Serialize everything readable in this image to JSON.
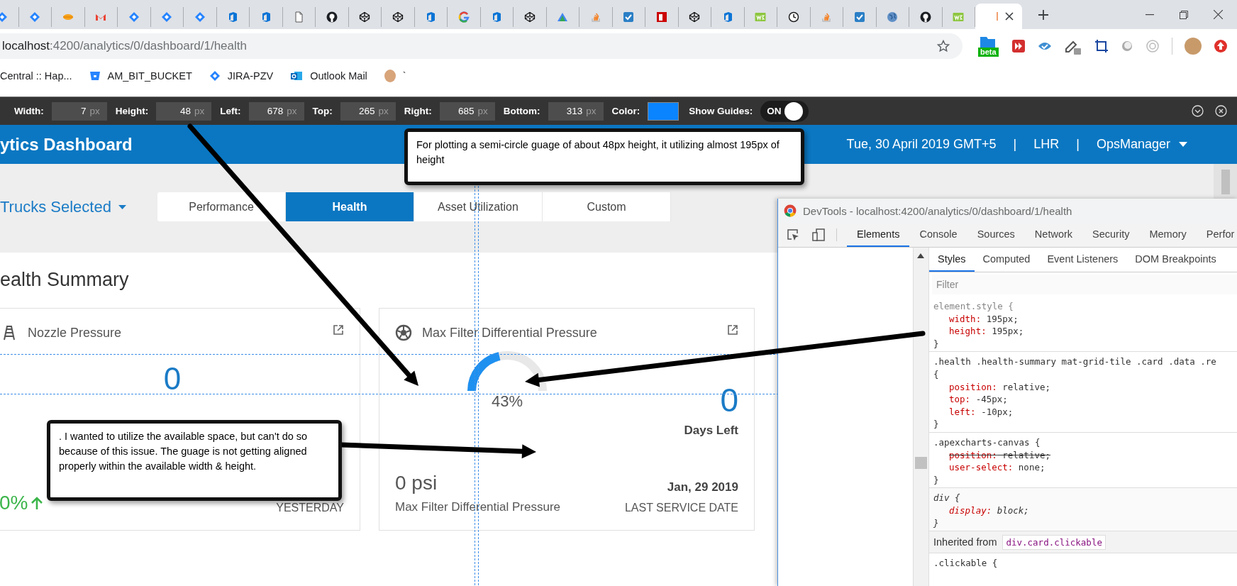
{
  "browser": {
    "tabs": [
      {
        "selected": false
      },
      {
        "selected": false
      },
      {
        "selected": false
      },
      {
        "selected": false
      },
      {
        "selected": false
      },
      {
        "selected": false
      },
      {
        "selected": false
      },
      {
        "selected": false
      },
      {
        "selected": false
      },
      {
        "selected": false
      },
      {
        "selected": false
      },
      {
        "selected": false
      },
      {
        "selected": false
      },
      {
        "selected": false
      },
      {
        "selected": false
      },
      {
        "selected": false
      },
      {
        "selected": false
      },
      {
        "selected": false
      },
      {
        "selected": false
      },
      {
        "selected": false
      },
      {
        "selected": false
      },
      {
        "selected": false
      },
      {
        "selected": false
      },
      {
        "selected": false
      },
      {
        "selected": false
      },
      {
        "selected": false
      },
      {
        "selected": false
      },
      {
        "selected": false
      },
      {
        "selected": false
      },
      {
        "selected": false
      },
      {
        "selected": true
      }
    ],
    "address": {
      "host": "localhost",
      "path": ":4200/analytics/0/dashboard/1/health"
    },
    "extension_badge": "beta",
    "bookmarks": [
      {
        "label": "Central :: Hap..."
      },
      {
        "label": "AM_BIT_BUCKET"
      },
      {
        "label": "JIRA-PZV"
      },
      {
        "label": "Outlook Mail"
      },
      {
        "label": "`"
      }
    ]
  },
  "measure_toolbar": {
    "fields": [
      {
        "label": "Width:",
        "value": "7",
        "unit": "px"
      },
      {
        "label": "Height:",
        "value": "48",
        "unit": "px"
      },
      {
        "label": "Left:",
        "value": "678",
        "unit": "px"
      },
      {
        "label": "Top:",
        "value": "265",
        "unit": "px"
      },
      {
        "label": "Right:",
        "value": "685",
        "unit": "px"
      },
      {
        "label": "Bottom:",
        "value": "313",
        "unit": "px"
      }
    ],
    "color_label": "Color:",
    "color": "#0a84ff",
    "guides_label": "Show Guides:",
    "guides_toggle": {
      "label": "ON",
      "on": true
    }
  },
  "app_header": {
    "title": "ytics Dashboard",
    "items": [
      "Tue, 30 April 2019 GMT+5",
      "|",
      "LHR",
      "|"
    ],
    "user": "OpsManager"
  },
  "nav": {
    "selector": "Trucks Selected",
    "tabs": [
      {
        "label": "Performance",
        "selected": false
      },
      {
        "label": "Health",
        "selected": true
      },
      {
        "label": "Asset Utilization",
        "selected": false
      },
      {
        "label": "Custom",
        "selected": false
      }
    ]
  },
  "section_title": "ealth Summary",
  "cards": [
    {
      "kind": "trend",
      "title": "Nozzle Pressure",
      "value": "0",
      "change": "0%",
      "period": "YESTERDAY"
    },
    {
      "kind": "gauge",
      "title": "Max Filter Differential Pressure",
      "gauge": {
        "label": "43%"
      },
      "value": "0",
      "value_label": "Days Left",
      "reading": "0 psi",
      "reading_label": "Max Filter Differential Pressure",
      "date": "Jan, 29 2019",
      "date_label": "LAST SERVICE DATE"
    }
  ],
  "devtools": {
    "title": "DevTools - localhost:4200/analytics/0/dashboard/1/health",
    "tabs": [
      {
        "label": "Elements",
        "selected": true
      },
      {
        "label": "Console",
        "selected": false
      },
      {
        "label": "Sources",
        "selected": false
      },
      {
        "label": "Network",
        "selected": false
      },
      {
        "label": "Security",
        "selected": false
      },
      {
        "label": "Memory",
        "selected": false
      },
      {
        "label": "Perfor",
        "selected": false
      }
    ],
    "subtabs": [
      {
        "label": "Styles",
        "selected": true
      },
      {
        "label": "Computed",
        "selected": false
      },
      {
        "label": "Event Listeners",
        "selected": false
      },
      {
        "label": "DOM Breakpoints",
        "selected": false
      }
    ],
    "filter": {
      "placeholder": "Filter"
    },
    "rules": [
      {
        "kind": "inline",
        "selector": "element.style {",
        "properties": [
          {
            "name": "width:",
            "value": "195px;",
            "overridden": false
          },
          {
            "name": "height:",
            "value": "195px;",
            "overridden": false
          }
        ],
        "close": "}"
      },
      {
        "kind": "author",
        "selector": ".health .health-summary mat-grid-tile .card .data .re",
        "open": "{",
        "properties": [
          {
            "name": "position:",
            "value": "relative;",
            "overridden": false
          },
          {
            "name": "top:",
            "value": "-45px;",
            "overridden": false
          },
          {
            "name": "left:",
            "value": "-10px;",
            "overridden": false
          }
        ],
        "close": "}"
      },
      {
        "kind": "author",
        "selector": ".apexcharts-canvas {",
        "properties": [
          {
            "name": "position:",
            "value": "relative;",
            "overridden": true
          },
          {
            "name": "user-select:",
            "value": "none;",
            "overridden": false
          }
        ],
        "close": "}"
      },
      {
        "kind": "user_agent",
        "selector": "div {",
        "properties": [
          {
            "name": "display:",
            "value": "block;",
            "overridden": false
          }
        ],
        "close": "}"
      }
    ],
    "inherited": {
      "label": "Inherited from",
      "source": "div.card.clickable"
    },
    "next_rule": ".clickable {"
  },
  "annotations": [
    {
      "text": "For plotting a semi-circle guage of about 48px height, it utilizing almost 195px of height"
    },
    {
      "text": ". I wanted to utilize the available space, but can't do so because of this issue. The guage is not getting aligned properly within the available width & height."
    }
  ]
}
